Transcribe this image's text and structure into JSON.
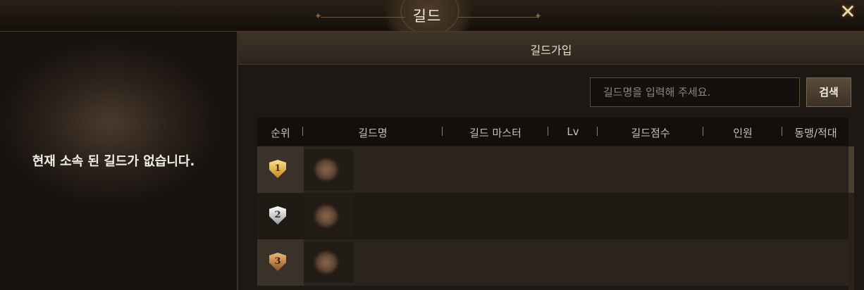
{
  "window": {
    "title": "길드",
    "close_icon": "close-x-icon"
  },
  "left_panel": {
    "message": "현재 소속 된 길드가 없습니다."
  },
  "join_panel": {
    "tab_title": "길드가입",
    "search": {
      "placeholder": "길드명을 입력해 주세요.",
      "button_label": "검색"
    },
    "table": {
      "headers": [
        "순위",
        "길드명",
        "길드 마스터",
        "Lv",
        "길드점수",
        "인원",
        "동맹/적대"
      ],
      "rows": [
        {
          "rank": "1",
          "badge_color": "#e8b64a",
          "guild_name": "",
          "master": "",
          "level": "",
          "score": "",
          "members": "",
          "relation": ""
        },
        {
          "rank": "2",
          "badge_color": "#d8d8d8",
          "guild_name": "",
          "master": "",
          "level": "",
          "score": "",
          "members": "",
          "relation": ""
        },
        {
          "rank": "3",
          "badge_color": "#c08048",
          "guild_name": "",
          "master": "",
          "level": "",
          "score": "",
          "members": "",
          "relation": ""
        }
      ]
    }
  }
}
